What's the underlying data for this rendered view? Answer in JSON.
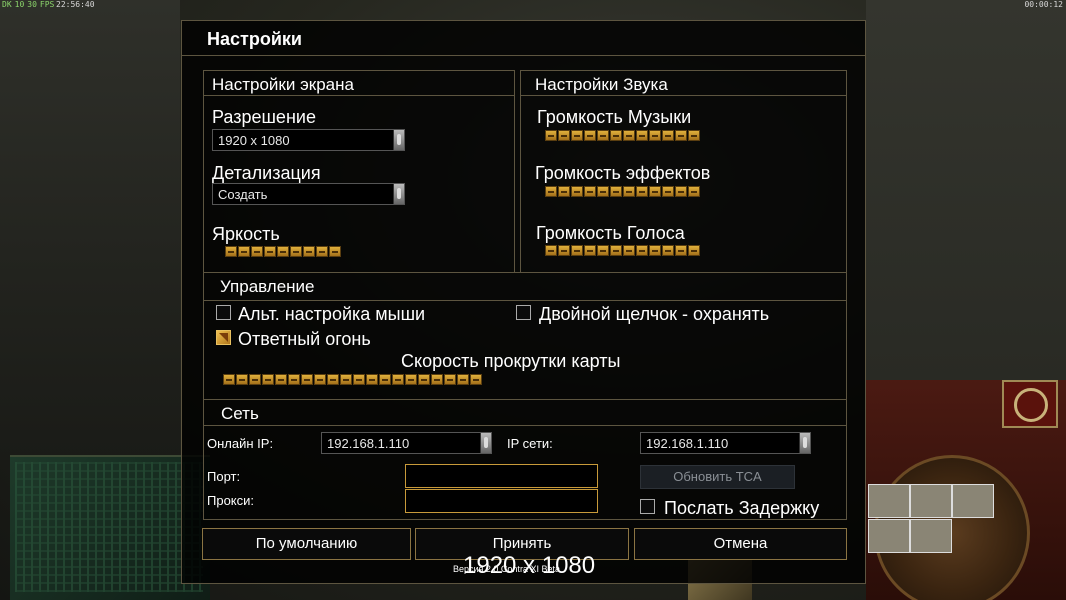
{
  "topbar": {
    "fps": [
      "DK",
      "10",
      "30",
      "FPS"
    ],
    "clock_left": "22:56:40",
    "clock_right": "00:00:12"
  },
  "dialog": {
    "title": "Настройки"
  },
  "display": {
    "title": "Настройки экрана",
    "resolution_label": "Разрешение",
    "resolution_value": "1920 x 1080",
    "detail_label": "Детализация",
    "detail_value": "Создать",
    "brightness_label": "Яркость",
    "brightness_level": 1.0
  },
  "sound": {
    "title": "Настройки Звука",
    "music_label": "Громкость Музыки",
    "music_level": 1.0,
    "effects_label": "Громкость эффектов",
    "effects_level": 1.0,
    "voice_label": "Громкость Голоса",
    "voice_level": 1.0
  },
  "controls": {
    "title": "Управление",
    "alt_mouse_label": "Альт. настройка мыши",
    "alt_mouse_checked": false,
    "double_click_label": "Двойной щелчок - охранять",
    "double_click_checked": false,
    "return_fire_label": "Ответный огонь",
    "return_fire_checked": true,
    "scroll_speed_label": "Скорость прокрутки карты",
    "scroll_speed_level": 1.0
  },
  "network": {
    "title": "Сеть",
    "online_ip_label": "Онлайн IP:",
    "online_ip_value": "192.168.1.110",
    "lan_ip_label": "IP сети:",
    "lan_ip_value": "192.168.1.110",
    "port_label": "Порт:",
    "proxy_label": "Прокси:",
    "update_tca_label": "Обновить TCA",
    "send_delay_label": "Послать Задержку",
    "send_delay_checked": false
  },
  "buttons": {
    "defaults": "По умолчанию",
    "accept": "Принять",
    "cancel": "Отмена"
  },
  "footer": {
    "version": "Версия 2.0 Contra XI Beta",
    "resolution": "1920 x 1080"
  }
}
